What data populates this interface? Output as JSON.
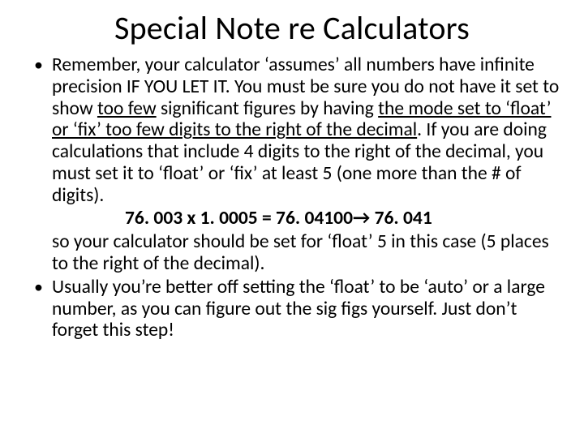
{
  "title": "Special Note re Calculators",
  "b1": {
    "p1a": "Remember, your calculator ‘assumes’ all numbers have infinite precision IF YOU LET IT.  You must be sure you do not have it set to show ",
    "u1": "too few",
    "p1b": " significant figures by having ",
    "u2": "the mode set to ‘float’ or ‘fix’ too few digits to the right of the decimal",
    "p1c": ".  If you are doing calculations that include 4 digits to the right of the decimal, you must set it to ‘float’ or ‘fix’ at least 5 (one more than the # of digits).",
    "eq": "76. 003 x 1. 0005 = 76. 04100→ 76. 041",
    "p2": "so your calculator should be set for ‘float’ 5 in this case (5 places to the right of the decimal)."
  },
  "b2": "Usually you’re better off setting the ‘float’ to be ‘auto’ or a large number, as you can figure out the sig figs yourself.  Just don’t forget this step!"
}
